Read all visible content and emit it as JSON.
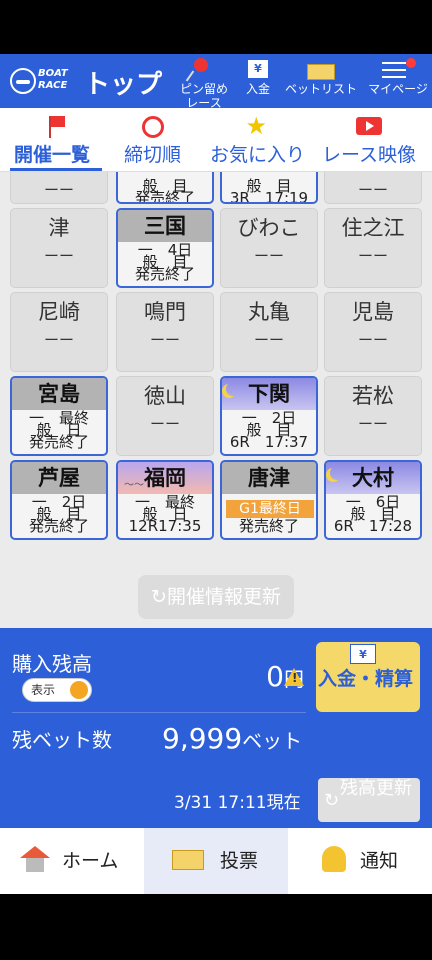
{
  "header": {
    "logo_line1": "BOAT",
    "logo_line2": "RACE",
    "title": "トップ",
    "actions": [
      {
        "label_line1": "ピン留め",
        "label_line2": "レース",
        "icon": "pin-icon"
      },
      {
        "label_line1": "入金",
        "icon": "yen-slip-icon"
      },
      {
        "label_line1": "ベットリスト",
        "icon": "ticket-icon"
      },
      {
        "label_line1": "マイページ",
        "icon": "menu-icon",
        "badge": true
      }
    ]
  },
  "tabs": [
    {
      "label": "開催一覧",
      "icon": "flag-icon",
      "active": true
    },
    {
      "label": "締切順",
      "icon": "alarm-clock-icon",
      "active": false
    },
    {
      "label": "お気に入り",
      "icon": "star-icon",
      "active": false
    },
    {
      "label": "レース映像",
      "icon": "video-icon",
      "active": false
    }
  ],
  "venues": {
    "row0": [
      {
        "dash": "ーー"
      },
      {
        "l1": "一　日",
        "l2": "般　目",
        "l3": "発売終了"
      },
      {
        "l1": "一　日",
        "l2": "般　目",
        "l3": "3R　17:19"
      },
      {
        "dash": "ーー"
      }
    ],
    "row1": [
      {
        "name": "津",
        "dash": "ーー"
      },
      {
        "name": "三国",
        "l1": "一　4日",
        "l2": "般　目",
        "l3": "発売終了"
      },
      {
        "name": "びわこ",
        "dash": "ーー"
      },
      {
        "name": "住之江",
        "dash": "ーー"
      }
    ],
    "row2": [
      {
        "name": "尼崎",
        "dash": "ーー"
      },
      {
        "name": "鳴門",
        "dash": "ーー"
      },
      {
        "name": "丸亀",
        "dash": "ーー"
      },
      {
        "name": "児島",
        "dash": "ーー"
      }
    ],
    "row3": [
      {
        "name": "宮島",
        "l1": "一　最終",
        "l2": "般　日",
        "l3": "発売終了"
      },
      {
        "name": "徳山",
        "dash": "ーー"
      },
      {
        "name": "下関",
        "l1": "一　2日",
        "l2": "般　目",
        "l3": "6R　17:37"
      },
      {
        "name": "若松",
        "dash": "ーー"
      }
    ],
    "row4": [
      {
        "name": "芦屋",
        "l1": "一　2日",
        "l2": "般　目",
        "l3": "発売終了"
      },
      {
        "name": "福岡",
        "l1": "一　最終",
        "l2": "般　日",
        "l3": "12R17:35"
      },
      {
        "name": "唐津",
        "grade": "G1最終日",
        "l3": "発売終了"
      },
      {
        "name": "大村",
        "l1": "一　6日",
        "l2": "般　目",
        "l3": "6R　17:28"
      }
    ]
  },
  "refresh_button": "開催情報更新",
  "balance": {
    "label": "購入残高",
    "toggle_label": "表示",
    "amount": "0",
    "amount_unit": "円",
    "bets_label": "残ベット数",
    "bets_value": "9,999",
    "bets_unit": "ベット",
    "deposit_button": "入金・精算",
    "timestamp": "3/31 17:11現在",
    "refresh_button": "残高更新"
  },
  "bottom_nav": [
    {
      "label": "ホーム",
      "icon": "home-icon"
    },
    {
      "label": "投票",
      "icon": "ballot-ticket-icon",
      "active": true
    },
    {
      "label": "通知",
      "icon": "bell-icon"
    }
  ],
  "colors": {
    "primary": "#2c5fd8",
    "accent_yellow": "#f5d86a",
    "grade_orange": "#f2a33b"
  }
}
